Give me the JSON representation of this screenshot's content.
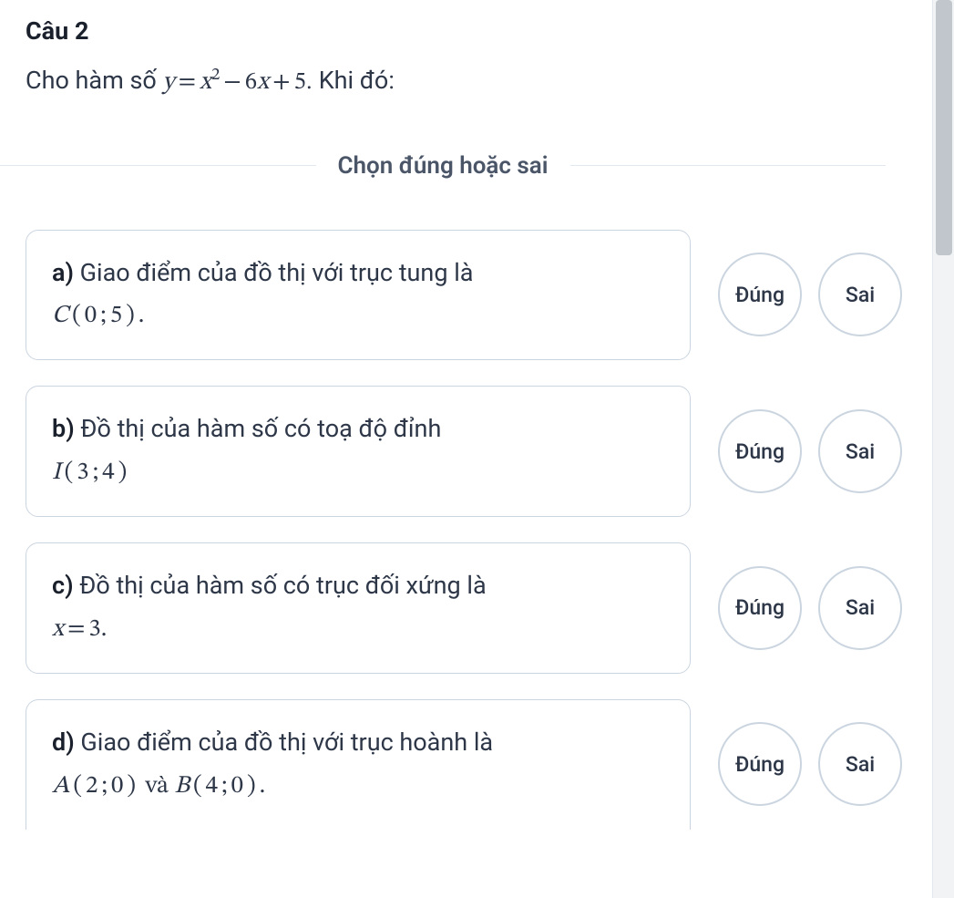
{
  "question": {
    "title": "Câu 2",
    "prompt_prefix": "Cho hàm số ",
    "prompt_suffix": ". Khi đó:",
    "formula_display": "y = x² − 6x + 5"
  },
  "divider": {
    "label": "Chọn đúng hoặc sai"
  },
  "buttons": {
    "true_label": "Đúng",
    "false_label": "Sai"
  },
  "options": [
    {
      "label": "a)",
      "text": " Giao điểm của đồ thị với trục tung là ",
      "math_display": "C ( 0 ; 5 ) ."
    },
    {
      "label": "b)",
      "text": " Đồ thị của hàm số có toạ độ đỉnh ",
      "math_display": "I ( 3 ; 4 )"
    },
    {
      "label": "c)",
      "text": " Đồ thị của hàm số có trục đối xứng là ",
      "math_display": "x = 3."
    },
    {
      "label": "d)",
      "text": " Giao điểm của đồ thị với trục hoành là ",
      "math_display": "A ( 2 ; 0 ) và B ( 4 ; 0 ) ."
    }
  ]
}
